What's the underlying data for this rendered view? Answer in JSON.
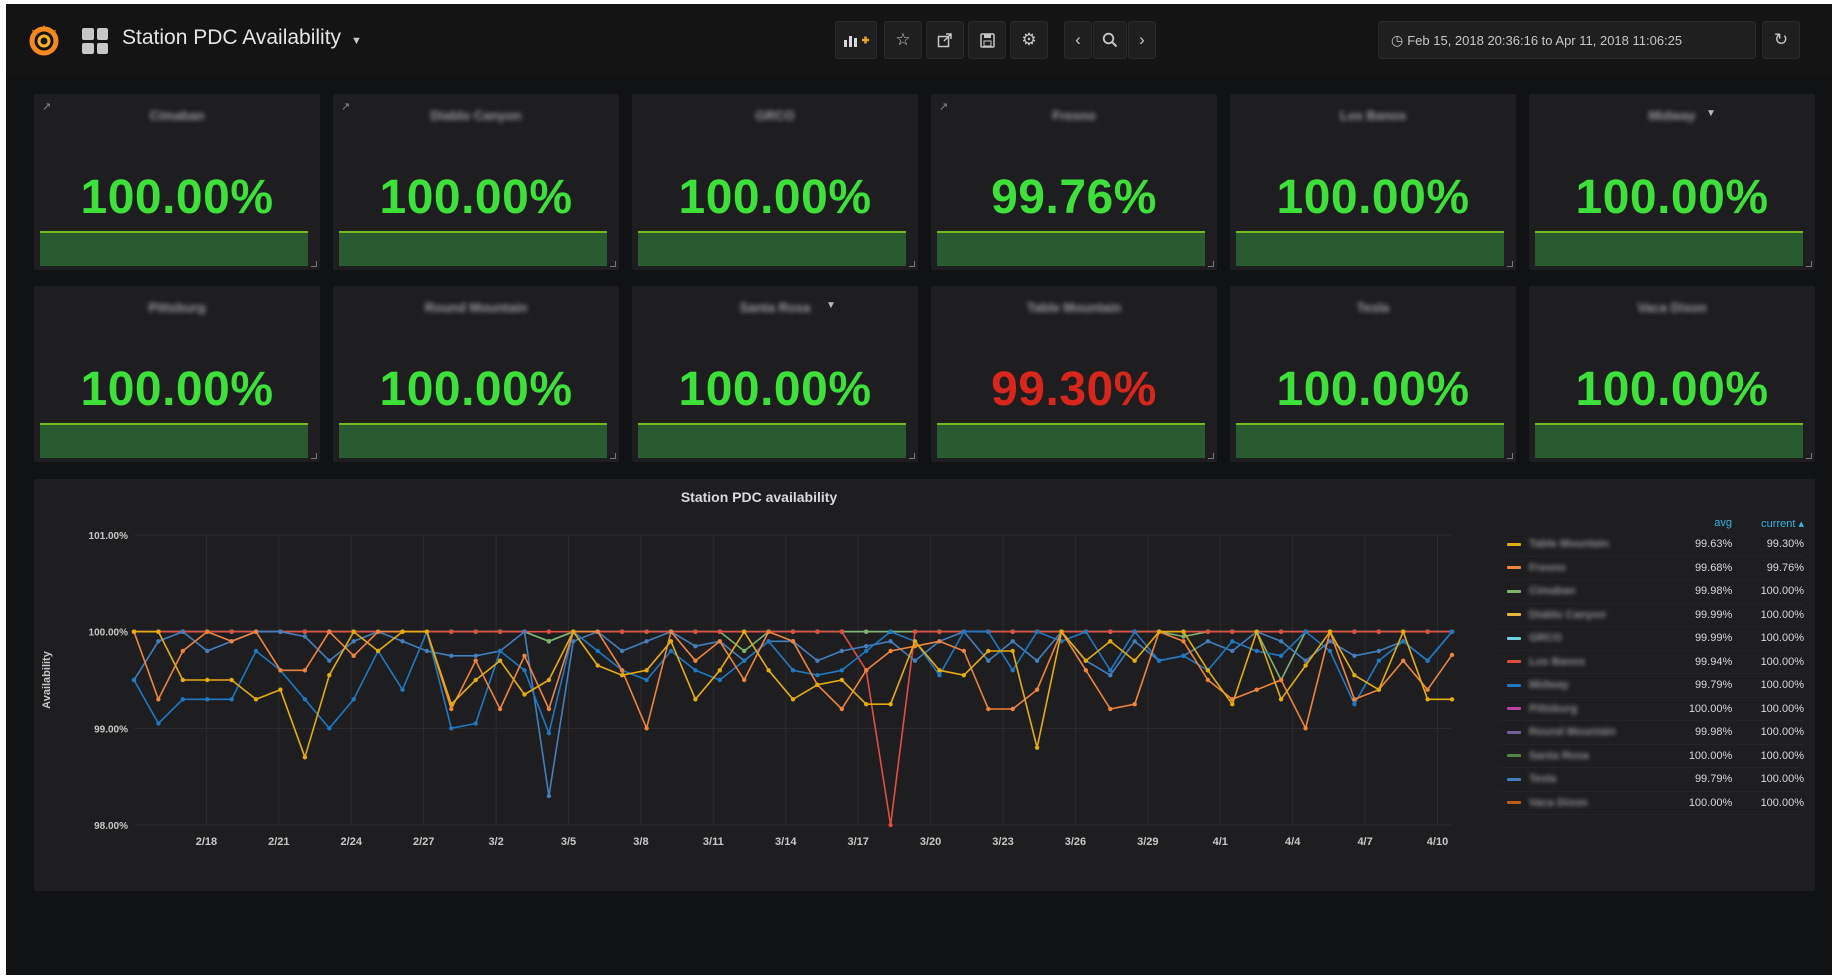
{
  "navbar": {
    "title": "Station PDC Availability",
    "time_range": "Feb 15, 2018 20:36:16 to Apr 11, 2018 11:06:25"
  },
  "colors": {
    "green": "#3ee03a",
    "red": "#d9261c",
    "spark_fill": "#2a5a2f",
    "spark_line": "#78b81f",
    "legend_header": "#33b5e5"
  },
  "stat_panels": [
    {
      "title": "Cimaban",
      "value": "100.00%",
      "status": "green"
    },
    {
      "title": "Diablo Canyon",
      "value": "100.00%",
      "status": "green"
    },
    {
      "title": "GRCO",
      "value": "100.00%",
      "status": "green"
    },
    {
      "title": "Fresno",
      "value": "99.76%",
      "status": "green"
    },
    {
      "title": "Los Banos",
      "value": "100.00%",
      "status": "green"
    },
    {
      "title": "Midway",
      "value": "100.00%",
      "status": "green"
    },
    {
      "title": "Pittsburg",
      "value": "100.00%",
      "status": "green"
    },
    {
      "title": "Round Mountain",
      "value": "100.00%",
      "status": "green"
    },
    {
      "title": "Santa Rosa",
      "value": "100.00%",
      "status": "green"
    },
    {
      "title": "Table Mountain",
      "value": "99.30%",
      "status": "red"
    },
    {
      "title": "Tesla",
      "value": "100.00%",
      "status": "green"
    },
    {
      "title": "Vaca Dixon",
      "value": "100.00%",
      "status": "green"
    }
  ],
  "graph": {
    "title": "Station PDC availability",
    "legend_header": {
      "avg": "avg",
      "current": "current ▴"
    },
    "legend": [
      {
        "name": "Table Mountain",
        "avg": "99.63%",
        "current": "99.30%",
        "color": "#e5ac0e"
      },
      {
        "name": "Fresno",
        "avg": "99.68%",
        "current": "99.76%",
        "color": "#ef843c"
      },
      {
        "name": "Cimaban",
        "avg": "99.98%",
        "current": "100.00%",
        "color": "#7eb26d"
      },
      {
        "name": "Diablo Canyon",
        "avg": "99.99%",
        "current": "100.00%",
        "color": "#eab839"
      },
      {
        "name": "GRCO",
        "avg": "99.99%",
        "current": "100.00%",
        "color": "#6ed0e0"
      },
      {
        "name": "Los Banos",
        "avg": "99.94%",
        "current": "100.00%",
        "color": "#e24d42"
      },
      {
        "name": "Midway",
        "avg": "99.79%",
        "current": "100.00%",
        "color": "#1f78c1"
      },
      {
        "name": "Pittsburg",
        "avg": "100.00%",
        "current": "100.00%",
        "color": "#ba43a9"
      },
      {
        "name": "Round Mountain",
        "avg": "99.98%",
        "current": "100.00%",
        "color": "#705da0"
      },
      {
        "name": "Santa Rosa",
        "avg": "100.00%",
        "current": "100.00%",
        "color": "#508642"
      },
      {
        "name": "Tesla",
        "avg": "99.79%",
        "current": "100.00%",
        "color": "#447ebc"
      },
      {
        "name": "Vaca Dixon",
        "avg": "100.00%",
        "current": "100.00%",
        "color": "#c15c17"
      }
    ]
  },
  "chart_data": {
    "type": "line",
    "title": "Station PDC availability",
    "ylabel": "Availability",
    "xlabel": "",
    "y_tick_labels": [
      "101.00%",
      "100.00%",
      "99.00%",
      "98.00%"
    ],
    "ylim": [
      98,
      101
    ],
    "x_tick_labels": [
      "2/18",
      "2/21",
      "2/24",
      "2/27",
      "3/2",
      "3/5",
      "3/8",
      "3/11",
      "3/14",
      "3/17",
      "3/20",
      "3/23",
      "3/26",
      "3/29",
      "4/1",
      "4/4",
      "4/7",
      "4/10"
    ],
    "x_range_days": [
      0,
      54.6
    ],
    "series": [
      {
        "name": "Table Mountain",
        "values": [
          100.0,
          100.0,
          99.5,
          99.5,
          99.5,
          99.3,
          99.4,
          98.7,
          99.55,
          100.0,
          99.8,
          100.0,
          100.0,
          99.25,
          99.5,
          99.7,
          99.35,
          99.5,
          100.0,
          99.65,
          99.55,
          99.6,
          99.9,
          99.3,
          99.6,
          100.0,
          99.6,
          99.3,
          99.45,
          99.5,
          99.25,
          99.25,
          99.9,
          99.6,
          99.55,
          99.8,
          99.8,
          98.8,
          100.0,
          99.7,
          99.9,
          99.7,
          100.0,
          100.0,
          99.6,
          99.25,
          100.0,
          99.3,
          99.65,
          100.0,
          99.55,
          99.4,
          100.0,
          99.3,
          99.3
        ],
        "color": "#e5ac0e"
      },
      {
        "name": "Fresno",
        "values": [
          100.0,
          99.3,
          99.8,
          100.0,
          99.9,
          100.0,
          99.6,
          99.6,
          100.0,
          99.75,
          100.0,
          100.0,
          100.0,
          99.2,
          99.7,
          99.2,
          99.75,
          99.2,
          100.0,
          100.0,
          99.6,
          99.0,
          100.0,
          99.7,
          99.9,
          99.5,
          100.0,
          99.9,
          99.45,
          99.2,
          99.6,
          99.8,
          99.85,
          99.9,
          99.8,
          99.2,
          99.2,
          99.4,
          100.0,
          99.6,
          99.2,
          99.25,
          100.0,
          99.9,
          99.5,
          99.3,
          99.4,
          99.5,
          99.0,
          100.0,
          99.3,
          99.4,
          99.7,
          99.4,
          99.76
        ],
        "color": "#ef843c"
      },
      {
        "name": "Midway",
        "values": [
          99.5,
          99.05,
          99.3,
          99.3,
          99.3,
          99.8,
          99.6,
          99.3,
          99.0,
          99.3,
          99.8,
          99.4,
          100.0,
          99.0,
          99.05,
          99.8,
          99.6,
          98.95,
          100.0,
          99.8,
          99.6,
          99.5,
          99.8,
          99.6,
          99.5,
          99.7,
          99.9,
          99.6,
          99.55,
          99.6,
          99.8,
          100.0,
          99.9,
          99.55,
          100.0,
          100.0,
          99.6,
          100.0,
          99.9,
          100.0,
          99.6,
          100.0,
          99.7,
          99.75,
          99.6,
          99.9,
          99.8,
          99.75,
          100.0,
          99.8,
          99.25,
          99.7,
          99.9,
          99.7,
          100.0
        ],
        "color": "#1f78c1"
      },
      {
        "name": "Tesla",
        "values": [
          99.5,
          99.9,
          100.0,
          99.8,
          99.9,
          100.0,
          100.0,
          99.95,
          99.7,
          99.9,
          100.0,
          99.9,
          99.8,
          99.75,
          99.75,
          99.8,
          100.0,
          98.3,
          99.9,
          100.0,
          99.8,
          99.9,
          100.0,
          99.85,
          99.9,
          99.7,
          99.9,
          99.9,
          99.7,
          99.8,
          99.85,
          99.9,
          99.7,
          99.9,
          100.0,
          99.7,
          99.9,
          99.7,
          100.0,
          99.7,
          99.55,
          99.9,
          99.7,
          99.75,
          99.9,
          99.8,
          100.0,
          99.9,
          99.7,
          99.9,
          99.75,
          99.8,
          99.9,
          99.7,
          100.0
        ],
        "color": "#447ebc"
      },
      {
        "name": "Los Banos",
        "values": [
          100.0,
          100.0,
          100.0,
          100.0,
          100.0,
          100.0,
          100.0,
          100.0,
          100.0,
          100.0,
          100.0,
          100.0,
          100.0,
          100.0,
          100.0,
          100.0,
          100.0,
          100.0,
          100.0,
          100.0,
          100.0,
          100.0,
          100.0,
          100.0,
          100.0,
          100.0,
          100.0,
          100.0,
          100.0,
          100.0,
          99.6,
          98.0,
          100.0,
          100.0,
          100.0,
          100.0,
          100.0,
          100.0,
          100.0,
          100.0,
          100.0,
          100.0,
          100.0,
          100.0,
          100.0,
          100.0,
          100.0,
          100.0,
          100.0,
          100.0,
          100.0,
          100.0,
          100.0,
          100.0,
          100.0
        ],
        "color": "#e24d42"
      },
      {
        "name": "Cimaban",
        "values": [
          100.0,
          100.0,
          100.0,
          100.0,
          100.0,
          100.0,
          100.0,
          100.0,
          100.0,
          100.0,
          100.0,
          100.0,
          100.0,
          100.0,
          100.0,
          100.0,
          100.0,
          99.9,
          100.0,
          100.0,
          100.0,
          100.0,
          100.0,
          100.0,
          100.0,
          99.8,
          100.0,
          100.0,
          100.0,
          100.0,
          100.0,
          100.0,
          100.0,
          100.0,
          100.0,
          100.0,
          100.0,
          100.0,
          100.0,
          100.0,
          100.0,
          100.0,
          100.0,
          99.95,
          100.0,
          100.0,
          100.0,
          99.5,
          100.0,
          100.0,
          100.0,
          100.0,
          100.0,
          100.0,
          100.0
        ],
        "color": "#7eb26d"
      },
      {
        "name": "GRCO",
        "values": [
          100.0,
          100.0,
          100.0,
          100.0,
          100.0,
          100.0,
          100.0,
          100.0,
          100.0,
          100.0,
          100.0,
          100.0,
          100.0,
          100.0,
          100.0,
          100.0,
          100.0,
          99.9,
          100.0,
          100.0,
          100.0,
          100.0,
          100.0,
          100.0,
          100.0,
          100.0,
          100.0,
          100.0,
          100.0,
          100.0,
          100.0,
          100.0,
          100.0,
          100.0,
          100.0,
          100.0,
          100.0,
          100.0,
          100.0,
          100.0,
          100.0,
          100.0,
          100.0,
          100.0,
          100.0,
          100.0,
          100.0,
          100.0,
          100.0,
          100.0,
          100.0,
          100.0,
          100.0,
          100.0,
          100.0
        ],
        "color": "#6ed0e0"
      },
      {
        "name": "Pittsburg",
        "values": [
          100.0,
          100.0,
          100.0,
          100.0,
          100.0,
          100.0,
          100.0,
          100.0,
          100.0,
          100.0,
          100.0,
          100.0,
          100.0,
          100.0,
          100.0,
          100.0,
          100.0,
          100.0,
          100.0,
          100.0,
          100.0,
          100.0,
          100.0,
          100.0,
          100.0,
          100.0,
          100.0,
          100.0,
          100.0,
          100.0,
          100.0,
          100.0,
          100.0,
          100.0,
          100.0,
          100.0,
          100.0,
          100.0,
          100.0,
          100.0,
          100.0,
          100.0,
          100.0,
          100.0,
          100.0,
          100.0,
          100.0,
          100.0,
          100.0,
          100.0,
          100.0,
          100.0,
          100.0,
          100.0,
          100.0
        ],
        "color": "#ba43a9"
      }
    ]
  }
}
